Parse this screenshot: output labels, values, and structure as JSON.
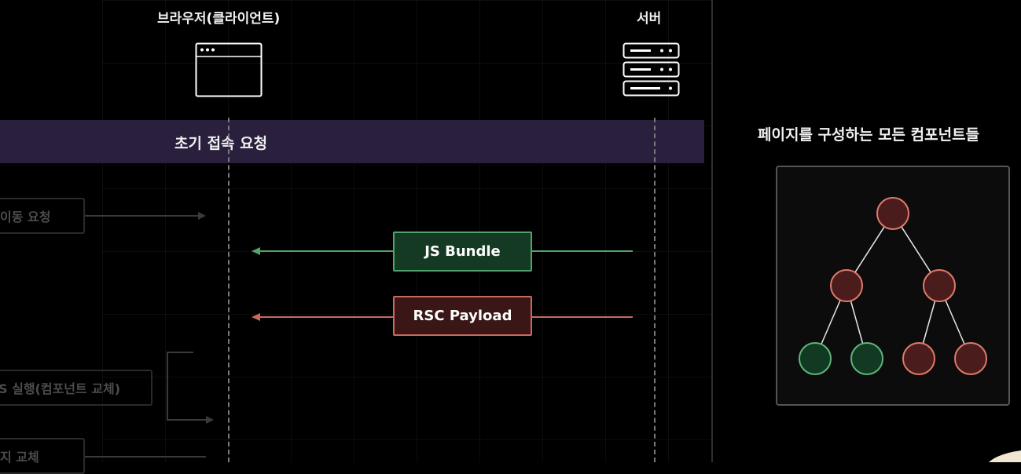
{
  "columns": {
    "client_label": "브라우저(클라이언트)",
    "server_label": "서버"
  },
  "band": {
    "label": "초기 접속 요청"
  },
  "faded_steps": [
    {
      "label": "이동 요청"
    },
    {
      "label": "S 실행(컴포넌트 교체)"
    },
    {
      "label": "지 교체"
    }
  ],
  "messages": [
    {
      "label": "JS Bundle",
      "color": "#4fa46b"
    },
    {
      "label": "RSC Payload",
      "color": "#c96a5e"
    }
  ],
  "tree": {
    "title": "페이지를 구성하는 모든 컴포넌트들",
    "node_colors": {
      "server_fill": "#4a1c1c",
      "server_stroke": "#e07a6c",
      "client_fill": "#123a22",
      "client_stroke": "#5fb57a"
    },
    "nodes": [
      {
        "id": "root",
        "kind": "server"
      },
      {
        "id": "left",
        "kind": "server"
      },
      {
        "id": "right",
        "kind": "server"
      },
      {
        "id": "left-left",
        "kind": "client"
      },
      {
        "id": "left-right",
        "kind": "client"
      },
      {
        "id": "right-left",
        "kind": "server"
      },
      {
        "id": "right-right",
        "kind": "server"
      }
    ]
  }
}
